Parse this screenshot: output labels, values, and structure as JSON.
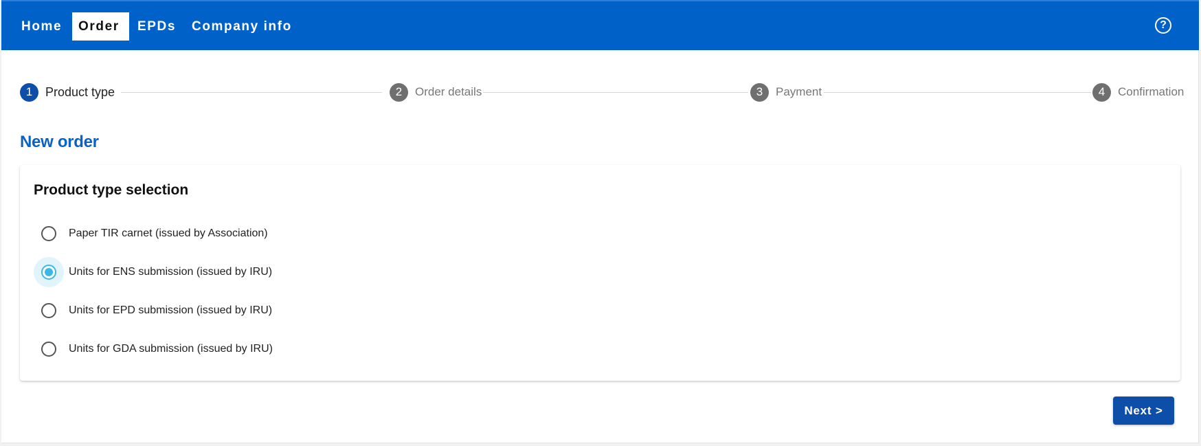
{
  "nav": {
    "items": [
      {
        "label": "Home",
        "active": false
      },
      {
        "label": "Order",
        "active": true
      },
      {
        "label": "EPDs",
        "active": false
      },
      {
        "label": "Company info",
        "active": false
      }
    ],
    "help_icon": "question-circle-icon"
  },
  "stepper": {
    "steps": [
      {
        "number": "1",
        "label": "Product type",
        "active": true
      },
      {
        "number": "2",
        "label": "Order details",
        "active": false
      },
      {
        "number": "3",
        "label": "Payment",
        "active": false
      },
      {
        "number": "4",
        "label": "Confirmation",
        "active": false
      }
    ]
  },
  "page": {
    "title": "New order"
  },
  "card": {
    "title": "Product type selection",
    "options": [
      {
        "label": "Paper TIR carnet (issued by Association)",
        "selected": false
      },
      {
        "label": "Units for ENS submission (issued by IRU)",
        "selected": true
      },
      {
        "label": "Units for EPD submission (issued by IRU)",
        "selected": false
      },
      {
        "label": "Units for GDA submission (issued by IRU)",
        "selected": false
      }
    ]
  },
  "actions": {
    "next_label": "Next >"
  },
  "colors": {
    "nav_bg": "#0061c9",
    "accent": "#0d4fa8",
    "title": "#0a62c6",
    "radio_selected": "#3bb8e8"
  }
}
